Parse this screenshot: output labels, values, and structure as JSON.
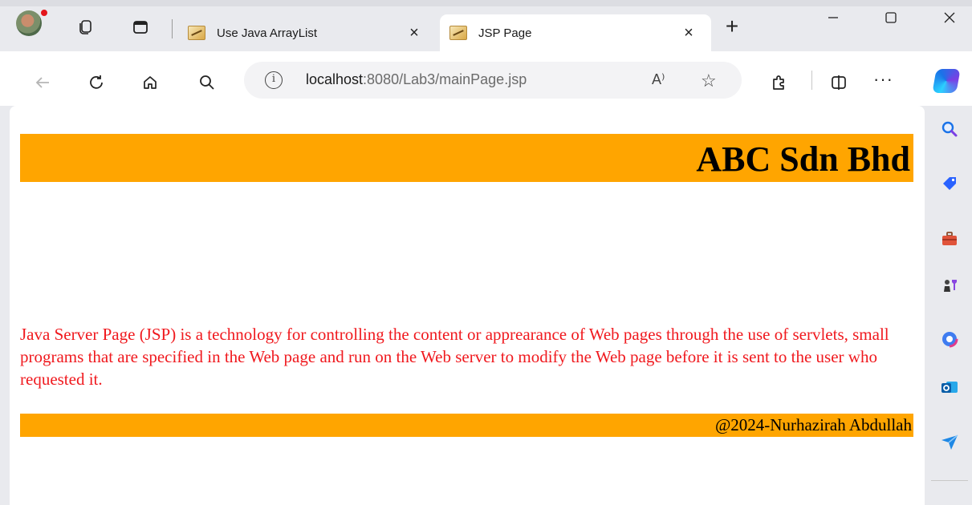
{
  "browser": {
    "tabs": [
      {
        "title": "Use Java ArrayList",
        "active": false
      },
      {
        "title": "JSP Page",
        "active": true
      }
    ],
    "tab_close_glyph": "×",
    "new_tab_glyph": "+",
    "address": {
      "host": "localhost",
      "rest": ":8080/Lab3/mainPage.jsp"
    },
    "read_aloud_glyph": "A⁾",
    "favorite_glyph": "☆",
    "more_glyph": "···"
  },
  "page": {
    "header_title": "ABC Sdn Bhd",
    "paragraph": "Java Server Page (JSP) is a technology for controlling the content or apprearance of Web pages through the use of servlets, small programs that are specified in the Web page and run on the Web server to modify the Web page before it is sent to the user who requested it.",
    "footer_text": "@2024-Nurhazirah Abdullah"
  },
  "colors": {
    "banner": "#ffa500",
    "paragraph_text": "#f0191e"
  },
  "icons": [
    "profile-avatar",
    "collections-icon",
    "tab-actions-icon",
    "back-icon",
    "refresh-icon",
    "home-icon",
    "search-icon",
    "info-icon",
    "read-aloud-icon",
    "favorite-star-icon",
    "extensions-icon",
    "split-screen-icon",
    "more-icon",
    "copilot-icon",
    "sidebar-search-icon",
    "shopping-tag-icon",
    "tools-icon",
    "games-icon",
    "office-icon",
    "outlook-icon",
    "send-icon"
  ]
}
